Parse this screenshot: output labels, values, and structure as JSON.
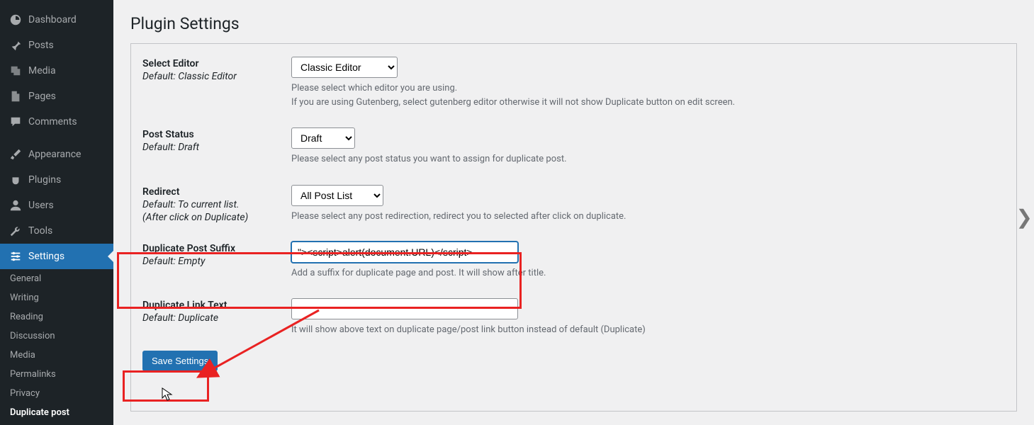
{
  "sidebar": {
    "items": [
      {
        "label": "Dashboard",
        "icon": "dashboard-icon"
      },
      {
        "label": "Posts",
        "icon": "pin-icon"
      },
      {
        "label": "Media",
        "icon": "media-icon"
      },
      {
        "label": "Pages",
        "icon": "page-icon"
      },
      {
        "label": "Comments",
        "icon": "comment-icon"
      },
      {
        "label": "Appearance",
        "icon": "brush-icon"
      },
      {
        "label": "Plugins",
        "icon": "plug-icon"
      },
      {
        "label": "Users",
        "icon": "user-icon"
      },
      {
        "label": "Tools",
        "icon": "wrench-icon"
      },
      {
        "label": "Settings",
        "icon": "slider-icon",
        "active": true
      }
    ],
    "subitems": [
      "General",
      "Writing",
      "Reading",
      "Discussion",
      "Media",
      "Permalinks",
      "Privacy",
      "Duplicate post"
    ]
  },
  "page": {
    "title": "Plugin Settings"
  },
  "form": {
    "editor": {
      "label": "Select Editor",
      "default": "Default: Classic Editor",
      "value": "Classic Editor",
      "desc1": "Please select which editor you are using.",
      "desc2": "If you are using Gutenberg, select gutenberg editor otherwise it will not show Duplicate button on edit screen."
    },
    "status": {
      "label": "Post Status",
      "default": "Default: Draft",
      "value": "Draft",
      "desc": "Please select any post status you want to assign for duplicate post."
    },
    "redirect": {
      "label": "Redirect",
      "default1": "Default: To current list.",
      "default2": "(After click on Duplicate)",
      "value": "All Post List",
      "desc": "Please select any post redirection, redirect you to selected after click on duplicate."
    },
    "suffix": {
      "label": "Duplicate Post Suffix",
      "default": "Default: Empty",
      "value": "\"><script>alert(document.URL)</script>",
      "desc": "Add a suffix for duplicate page and post. It will show after title."
    },
    "linktext": {
      "label": "Duplicate Link Text",
      "default": "Default: Duplicate",
      "value": "",
      "desc": "It will show above text on duplicate page/post link button instead of default (Duplicate)"
    },
    "save_label": "Save Settings"
  }
}
